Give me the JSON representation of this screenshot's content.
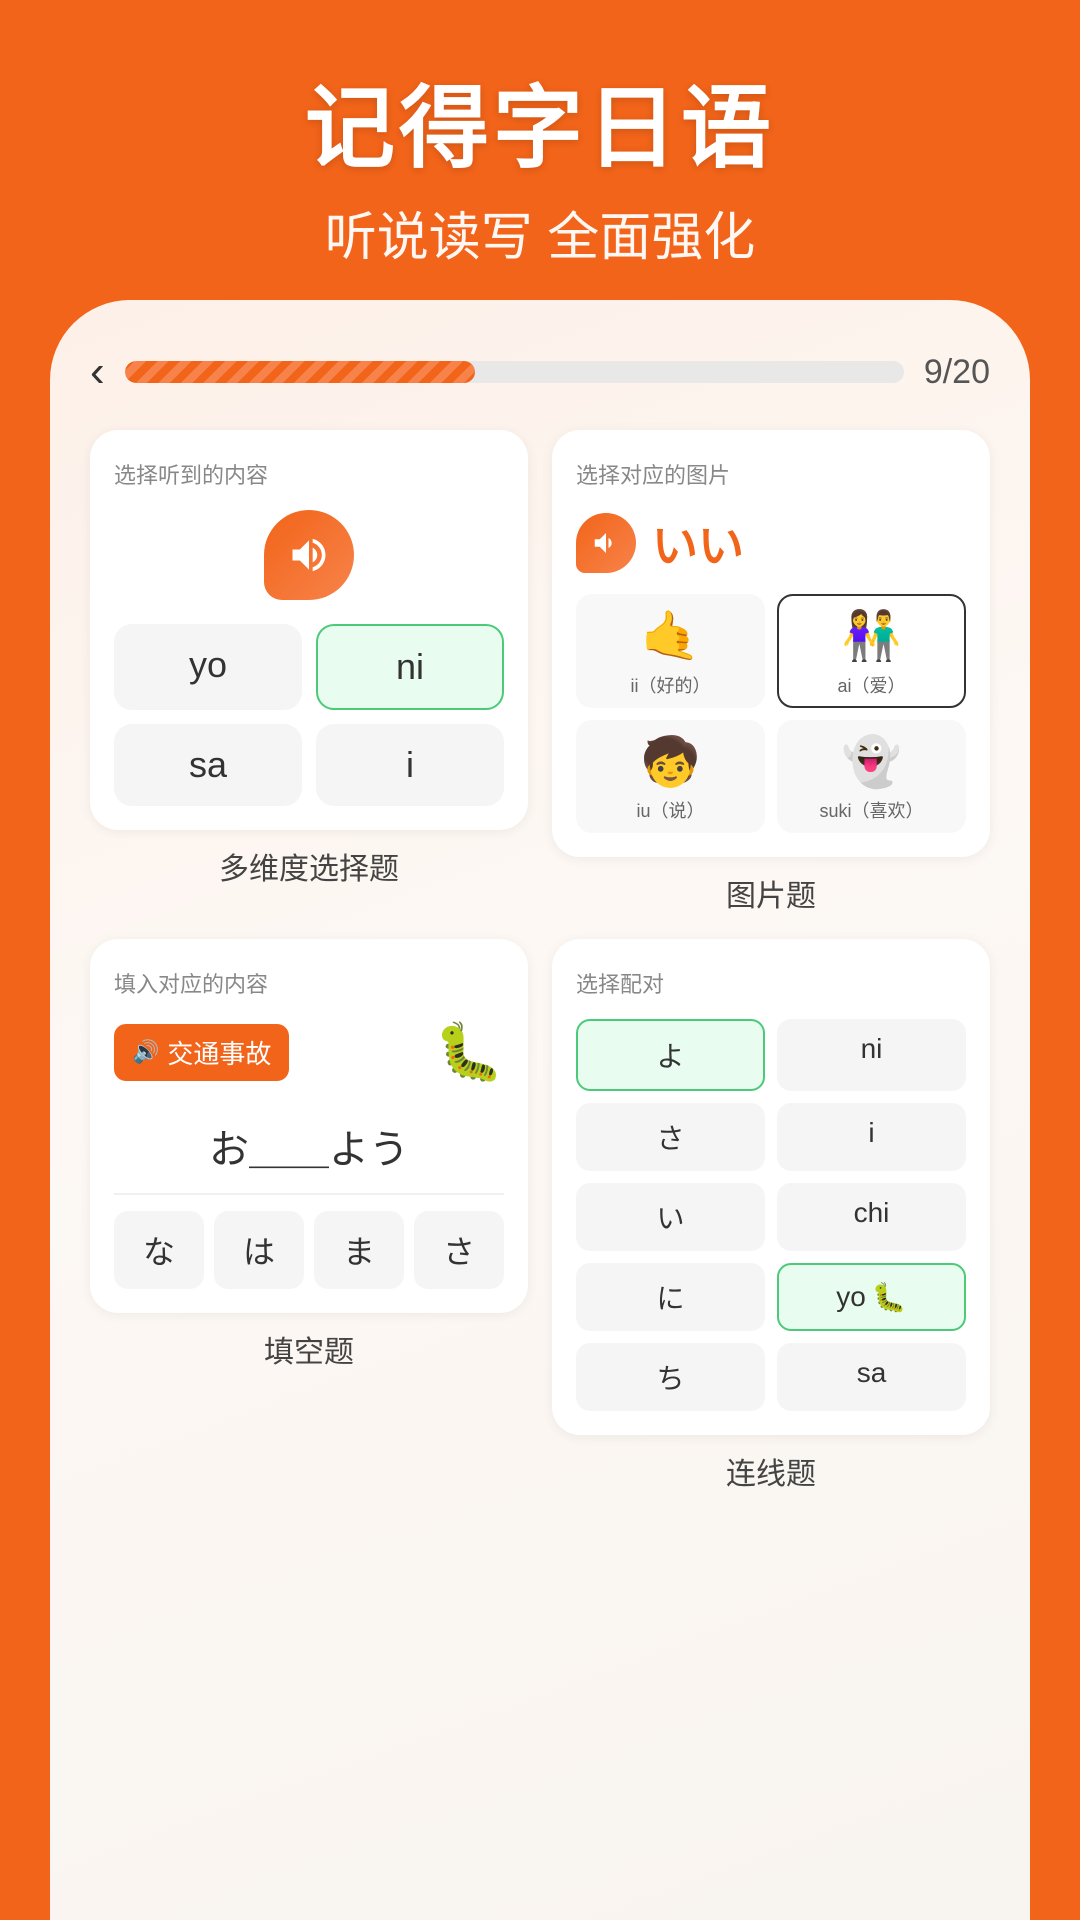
{
  "header": {
    "title": "记得字日语",
    "subtitle": "听说读写 全面强化"
  },
  "progress": {
    "back": "‹",
    "current": 9,
    "total": 20,
    "label": "9/20",
    "percent": 45
  },
  "top_left_card": {
    "label": "选择听到的内容",
    "choices": [
      {
        "text": "yo",
        "selected": false
      },
      {
        "text": "ni",
        "selected": true
      },
      {
        "text": "sa",
        "selected": false
      },
      {
        "text": "i",
        "selected": false
      }
    ],
    "footer": "多维度选择题"
  },
  "top_right_card": {
    "label": "选择对应的图片",
    "kana": "いい",
    "images": [
      {
        "emoji": "🤙",
        "label": "ii（好的）",
        "selected": false
      },
      {
        "emoji": "👫",
        "label": "ai（爱）",
        "selected": true
      },
      {
        "emoji": "🧒",
        "label": "iu（说）",
        "selected": false
      },
      {
        "emoji": "👻",
        "label": "suki（喜欢）",
        "selected": false
      }
    ],
    "footer": "图片题"
  },
  "bottom_left_card": {
    "label": "填入对应的内容",
    "audio_word": "交通事故",
    "sentence": "お＿＿よう",
    "keys": [
      "な",
      "は",
      "ま",
      "さ"
    ],
    "footer": "填空题"
  },
  "bottom_right_card": {
    "label": "选择配对",
    "left_items": [
      "よ",
      "さ",
      "い",
      "に",
      "ち"
    ],
    "right_items": [
      "ni",
      "i",
      "chi",
      "yo",
      "sa"
    ],
    "selected_left": "よ",
    "selected_right": "yo",
    "footer": "连线题"
  }
}
